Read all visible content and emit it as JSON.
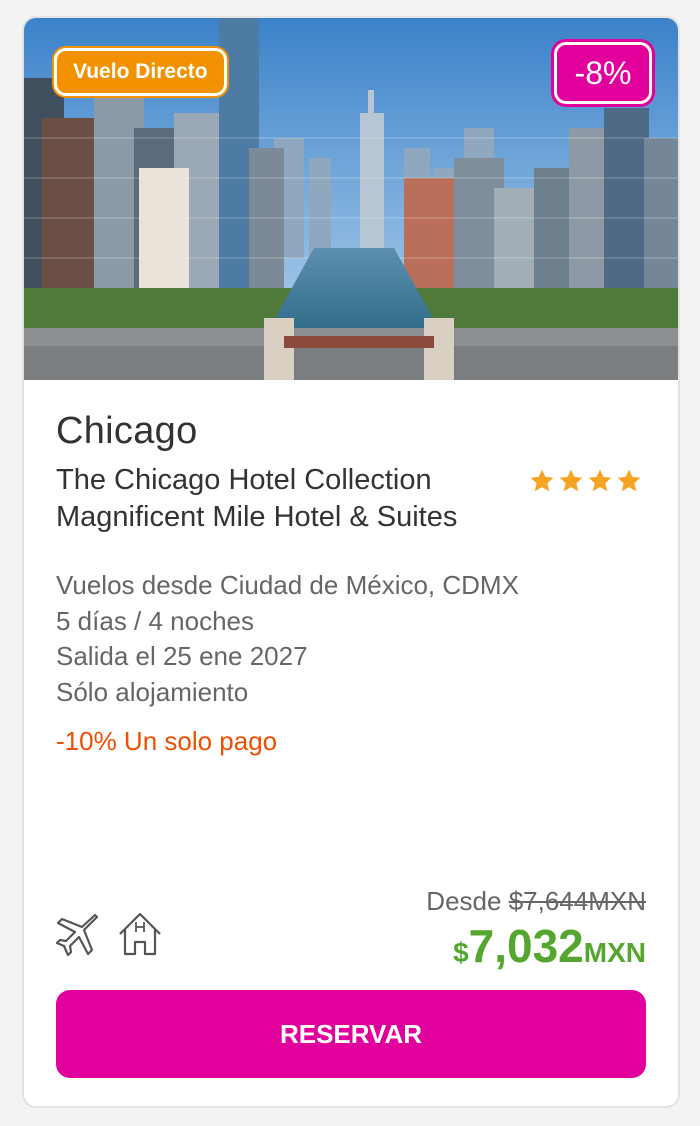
{
  "offer": {
    "badge_direct": "Vuelo Directo",
    "badge_discount": "-8%",
    "city": "Chicago",
    "hotel_name": "The Chicago Hotel Collection Magnificent Mile Hotel & Suites",
    "star_rating": 4,
    "details": [
      "Vuelos desde Ciudad de México, CDMX",
      "5 días / 4 noches",
      "Salida el 25 ene 2027",
      "Sólo alojamiento"
    ],
    "promo_text": "-10% Un solo pago",
    "included_icons": [
      "airplane-icon",
      "hotel-icon"
    ],
    "price": {
      "from_label": "Desde",
      "original": "$7,644MXN",
      "currency_symbol": "$",
      "amount": "7,032",
      "currency_unit": "MXN"
    },
    "cta_label": "RESERVAR"
  },
  "colors": {
    "brand": "#e1009b",
    "direct_badge": "#f39200",
    "price_green": "#55a630",
    "promo_orange": "#f04e00",
    "star": "#f7a325"
  }
}
